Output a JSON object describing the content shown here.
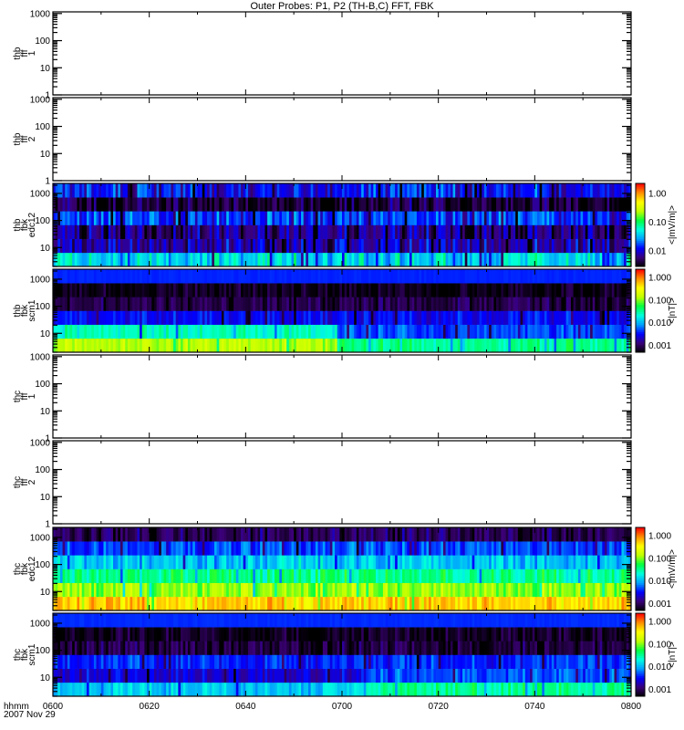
{
  "chart_data": {
    "type": "heatmap",
    "title": "Outer Probes: P1, P2 (TH-B,C) FFT, FBK",
    "x_axis": {
      "label_line1": "hhmm",
      "label_line2": "2007 Nov 29",
      "range_minutes": [
        360,
        480
      ],
      "tick_labels": [
        "0600",
        "0620",
        "0640",
        "0700",
        "0720",
        "0740",
        "0800"
      ],
      "tick_minutes": [
        360,
        380,
        400,
        420,
        440,
        460,
        480
      ],
      "minor_tick_step_minutes": 10
    },
    "panels": [
      {
        "label_lines": [
          "thb",
          "fff",
          "1"
        ],
        "kind": "empty",
        "ylim": [
          1,
          1150
        ],
        "ytick_values": [
          1,
          10,
          100,
          1000
        ],
        "ytick_labels": [
          "1",
          "10",
          "100",
          "1000"
        ]
      },
      {
        "label_lines": [
          "thb",
          "fff",
          "2"
        ],
        "kind": "empty",
        "ylim": [
          1,
          1150
        ],
        "ytick_values": [
          1,
          10,
          100,
          1000
        ],
        "ytick_labels": [
          "1",
          "10",
          "100",
          "1000"
        ]
      },
      {
        "label_lines": [
          "thb",
          "fbk",
          "edc12"
        ],
        "kind": "spectrogram",
        "ylim": [
          2,
          2340
        ],
        "ytick_values": [
          10,
          100,
          1000
        ],
        "ytick_labels": [
          "10",
          "100",
          "1000"
        ],
        "colorbar": {
          "unit": "<|mV/m|>",
          "range": [
            0.0029,
            2.2
          ],
          "tick_values": [
            0.01,
            0.1,
            1.0
          ],
          "tick_labels": [
            "0.01",
            "0.10",
            "1.00"
          ]
        },
        "band_log10_levels": [
          [
            -1.4,
            -2.1,
            -2.2,
            -1.8,
            -2.4,
            -1.9
          ]
        ],
        "segment_breaks_minutes": [],
        "spread": 0.4,
        "seed": 3
      },
      {
        "label_lines": [
          "thb",
          "fbk",
          "scm1"
        ],
        "kind": "spectrogram",
        "ylim": [
          2,
          2340
        ],
        "ytick_values": [
          10,
          100,
          1000
        ],
        "ytick_labels": [
          "10",
          "100",
          "1000"
        ],
        "colorbar": {
          "unit": "<|nT|>",
          "range": [
            0.0005,
            2.3
          ],
          "tick_values": [
            0.001,
            0.01,
            0.1,
            1.0
          ],
          "tick_labels": [
            "0.001",
            "0.010",
            "0.100",
            "1.000"
          ]
        },
        "band_log10_levels": [
          [
            -0.85,
            -1.6,
            -2.5,
            -3.05,
            -3.2,
            -2.4
          ],
          [
            -1.45,
            -2.3,
            -2.5,
            -3.05,
            -3.2,
            -2.4
          ]
        ],
        "segment_breaks_minutes": [
          419
        ],
        "spread": 0.25,
        "seed": 7
      },
      {
        "label_lines": [
          "thc",
          "fff",
          "1"
        ],
        "kind": "empty",
        "ylim": [
          1,
          1150
        ],
        "ytick_values": [
          1,
          10,
          100,
          1000
        ],
        "ytick_labels": [
          "1",
          "10",
          "100",
          "1000"
        ]
      },
      {
        "label_lines": [
          "thc",
          "fff",
          "2"
        ],
        "kind": "empty",
        "ylim": [
          1,
          1150
        ],
        "ytick_values": [
          1,
          10,
          100,
          1000
        ],
        "ytick_labels": [
          "1",
          "10",
          "100",
          "1000"
        ]
      },
      {
        "label_lines": [
          "thc",
          "fbk",
          "edc12"
        ],
        "kind": "spectrogram",
        "ylim": [
          2,
          2340
        ],
        "ytick_values": [
          10,
          100,
          1000
        ],
        "ytick_labels": [
          "10",
          "100",
          "1000"
        ],
        "colorbar": {
          "unit": "<|mV/m|>",
          "range": [
            0.0005,
            2.3
          ],
          "tick_values": [
            0.001,
            0.01,
            0.1,
            1.0
          ],
          "tick_labels": [
            "0.001",
            "0.010",
            "0.100",
            "1.000"
          ]
        },
        "band_log10_levels": [
          [
            -0.3,
            -0.95,
            -1.45,
            -1.9,
            -2.3,
            -3.0
          ]
        ],
        "segment_breaks_minutes": [],
        "spread": 0.35,
        "seed": 11
      },
      {
        "label_lines": [
          "thc",
          "fbk",
          "scm1"
        ],
        "kind": "spectrogram",
        "ylim": [
          2,
          2340
        ],
        "ytick_values": [
          10,
          100,
          1000
        ],
        "ytick_labels": [
          "10",
          "100",
          "1000"
        ],
        "colorbar": {
          "unit": "<|nT|>",
          "range": [
            0.0005,
            2.3
          ],
          "tick_values": [
            0.001,
            0.01,
            0.1,
            1.0
          ],
          "tick_labels": [
            "0.001",
            "0.010",
            "0.100",
            "1.000"
          ]
        },
        "band_log10_levels": [
          [
            -1.9,
            -2.6,
            -2.4,
            -3.08,
            -3.2,
            -2.38
          ],
          [
            -1.5,
            -2.3,
            -2.4,
            -3.08,
            -3.2,
            -2.38
          ]
        ],
        "segment_breaks_minutes": [
          425
        ],
        "spread": 0.3,
        "seed": 19
      }
    ],
    "colormap": [
      "#000000",
      "#3c0078",
      "#0000ff",
      "#00a0ff",
      "#00ffe0",
      "#00ff40",
      "#c0ff00",
      "#ffff00",
      "#ff9000",
      "#ff0000"
    ]
  }
}
